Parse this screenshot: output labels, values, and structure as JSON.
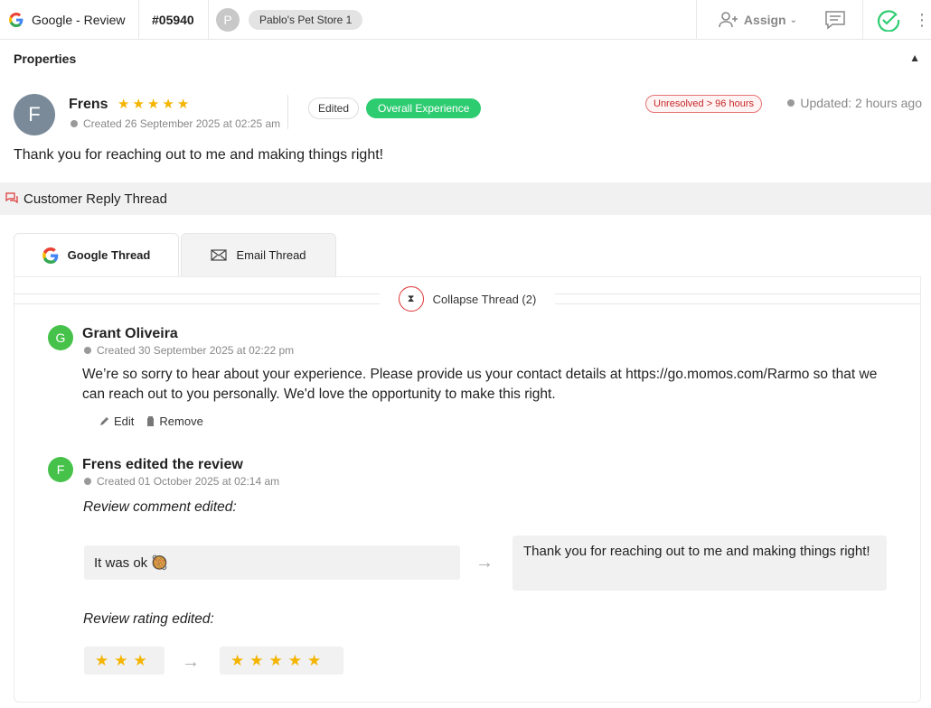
{
  "topbar": {
    "source_label": "Google - Review",
    "ticket_id": "#05940",
    "store_initial": "P",
    "store_name": "Pablo's Pet Store 1",
    "assign_label": "Assign",
    "source_icon": "google-icon",
    "assign_icon": "add-user-icon",
    "chat_icon": "comment-icon",
    "resolve_icon": "check-circle-icon",
    "more_icon": "more-vertical-icon"
  },
  "properties": {
    "title": "Properties"
  },
  "review": {
    "avatar_initial": "F",
    "reviewer_name": "Frens",
    "rating": 5,
    "stars": [
      "★",
      "★",
      "★",
      "★",
      "★"
    ],
    "created": "Created 26 September 2025 at 02:25 am",
    "chip_edited": "Edited",
    "chip_category": "Overall Experience",
    "status_badge": "Unresolved > 96 hours",
    "updated": "Updated: 2 hours ago",
    "text": "Thank you for reaching out to me and making things right!"
  },
  "reply_thread": {
    "title": "Customer Reply Thread",
    "tabs": [
      {
        "label": "Google Thread",
        "active": true
      },
      {
        "label": "Email Thread",
        "active": false
      }
    ],
    "collapse_label": "Collapse Thread (2)",
    "entries": [
      {
        "initial": "G",
        "name": "Grant Oliveira",
        "created": "Created 30 September 2025 at 02:22 pm",
        "text": "We’re so sorry to hear about your experience. Please provide us your contact details at https://go.momos.com/Rarmo so that we can reach out to you personally. We'd love the opportunity to make this right.",
        "edit_label": "Edit",
        "remove_label": "Remove"
      },
      {
        "initial": "F",
        "name": "Frens edited the review",
        "created": "Created 01 October 2025 at 02:14 am",
        "comment_edit_label": "Review comment edited:",
        "old_comment": "It was ok 🥘",
        "new_comment": "Thank you for reaching out to me and making things right!",
        "rating_edit_label": "Review rating edited:",
        "old_rating": 3,
        "new_rating": 5,
        "arrow": "→"
      }
    ]
  },
  "colors": {
    "star": "#f4b400",
    "overall_chip": "#2ecc71",
    "unresolved": "#c62828",
    "avatar_green": "#46c24a",
    "check_green": "#2ecc71"
  }
}
